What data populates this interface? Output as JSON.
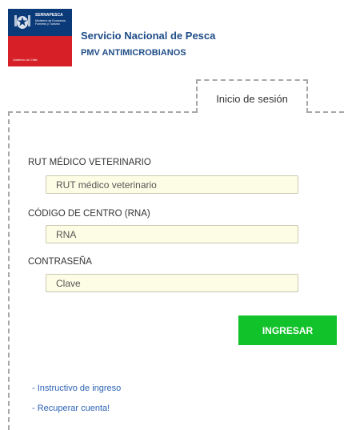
{
  "header": {
    "logo": {
      "agency": "SERNAPESCA",
      "ministry": "Ministerio de Economía, Fomento y Turismo",
      "government": "Gobierno de Chile",
      "crest_icon": "chile-coat-of-arms-icon",
      "colors": {
        "blue": "#0b3a78",
        "red": "#d61f26"
      }
    },
    "title": "Servicio Nacional de Pesca",
    "subtitle": "PMV ANTIMICROBIANOS"
  },
  "tab": {
    "label": "Inicio de sesión"
  },
  "form": {
    "rut": {
      "label": "RUT MÉDICO VETERINARIO",
      "placeholder": "RUT médico veterinario",
      "value": ""
    },
    "rna": {
      "label": "CÓDIGO DE CENTRO (RNA)",
      "placeholder": "RNA",
      "value": ""
    },
    "password": {
      "label": "CONTRASEÑA",
      "placeholder": "Clave",
      "value": ""
    },
    "submit_label": "INGRESAR"
  },
  "links": {
    "instructions": "- Instructivo de ingreso",
    "recover": "- Recuperar cuenta!"
  },
  "colors": {
    "brand_text": "#1f4d88",
    "button": "#11c22a",
    "link": "#2a62b4",
    "input_bg": "#fdfde6",
    "dashed_border": "#a8a8a8"
  }
}
